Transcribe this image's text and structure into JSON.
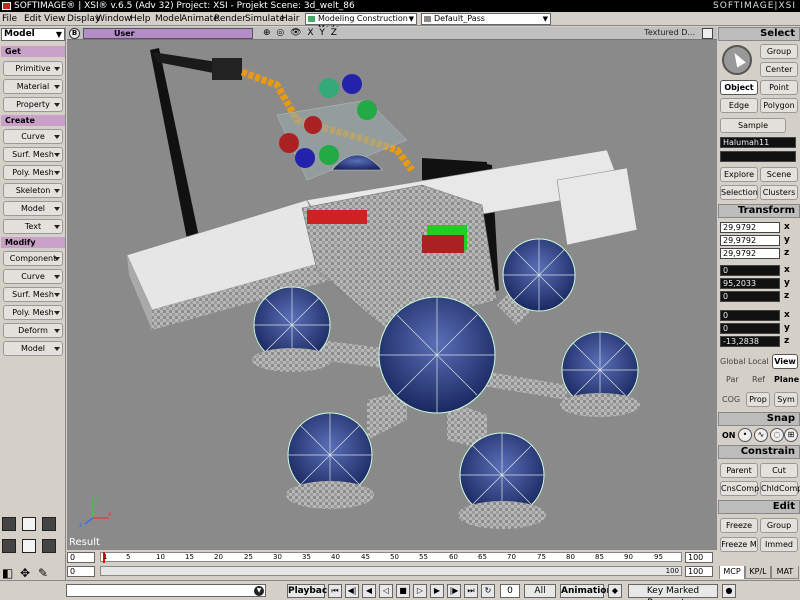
{
  "titlebar": {
    "text": "SOFTIMAGE® | XSI® v.6.5 (Adv 32) Project: XSI - Projekt    Scene: 3d_welt_86",
    "brand": "SOFTIMAGE|XSI"
  },
  "menu": {
    "items": [
      "File",
      "Edit",
      "View",
      "Display",
      "Window",
      "Help",
      "Model",
      "Animate",
      "Render",
      "Simulate",
      "Hair"
    ],
    "construction_mode": "Modeling Construction Mode",
    "pass": "Default_Pass",
    "select_header": "Select"
  },
  "left": {
    "module": "Model",
    "sections": [
      {
        "title": "Get",
        "buttons": [
          "Primitive",
          "Material",
          "Property"
        ]
      },
      {
        "title": "Create",
        "buttons": [
          "Curve",
          "Surf. Mesh",
          "Poly. Mesh",
          "Skeleton",
          "Model",
          "Text"
        ]
      },
      {
        "title": "Modify",
        "buttons": [
          "Component",
          "Curve",
          "Surf. Mesh",
          "Poly. Mesh",
          "Deform",
          "Model"
        ]
      }
    ]
  },
  "viewport": {
    "chip": "B",
    "camera": "User",
    "tools": "⊕ ◎ 👁 X Y Z",
    "shading": "Textured D...",
    "result_label": "Result"
  },
  "timeline": {
    "start": "0",
    "end": "100",
    "frame_start": "0",
    "frame_end": "100",
    "current": "1",
    "track_end": "100",
    "tick_labels": [
      "1",
      "5",
      "10",
      "15",
      "20",
      "25",
      "30",
      "35",
      "40",
      "45",
      "50",
      "55",
      "60",
      "65",
      "70",
      "75",
      "80",
      "85",
      "90",
      "95"
    ]
  },
  "playbar": {
    "playback": "Playback",
    "frame_field": "0",
    "all_label": "All",
    "animation": "Animation",
    "key_marked": "Key Marked Parameters"
  },
  "tabs": [
    "MCP",
    "KP/L",
    "MAT"
  ],
  "right": {
    "select": {
      "group": "Group",
      "center": "Center",
      "object": "Object",
      "point": "Point",
      "edge": "Edge",
      "polygon": "Polygon",
      "sample": "Sample",
      "name_field": "Halumah11",
      "explore": "Explore",
      "scene": "Scene",
      "selection": "Selection",
      "clusters": "Clusters"
    },
    "transform": {
      "header": "Transform",
      "scale": [
        "29,9792",
        "29,9792",
        "29,9792"
      ],
      "rotation": [
        "0",
        "95,2033",
        "0"
      ],
      "translation": [
        "0",
        "0",
        "-13,2838"
      ],
      "axes": [
        "x",
        "y",
        "z"
      ],
      "global": "Global",
      "local": "Local",
      "view": "View",
      "par": "Par",
      "ref": "Ref",
      "plane": "Plane",
      "cog": "COG",
      "prop": "Prop",
      "sym": "Sym"
    },
    "snap": {
      "header": "Snap",
      "on": "ON"
    },
    "constrain": {
      "header": "Constrain",
      "parent": "Parent",
      "cut": "Cut",
      "cnscomp": "CnsComp",
      "childcomp": "ChldComp"
    },
    "edit": {
      "header": "Edit",
      "freeze": "Freeze",
      "group": "Group",
      "freeze_m": "Freeze M",
      "immed": "Immed"
    }
  }
}
